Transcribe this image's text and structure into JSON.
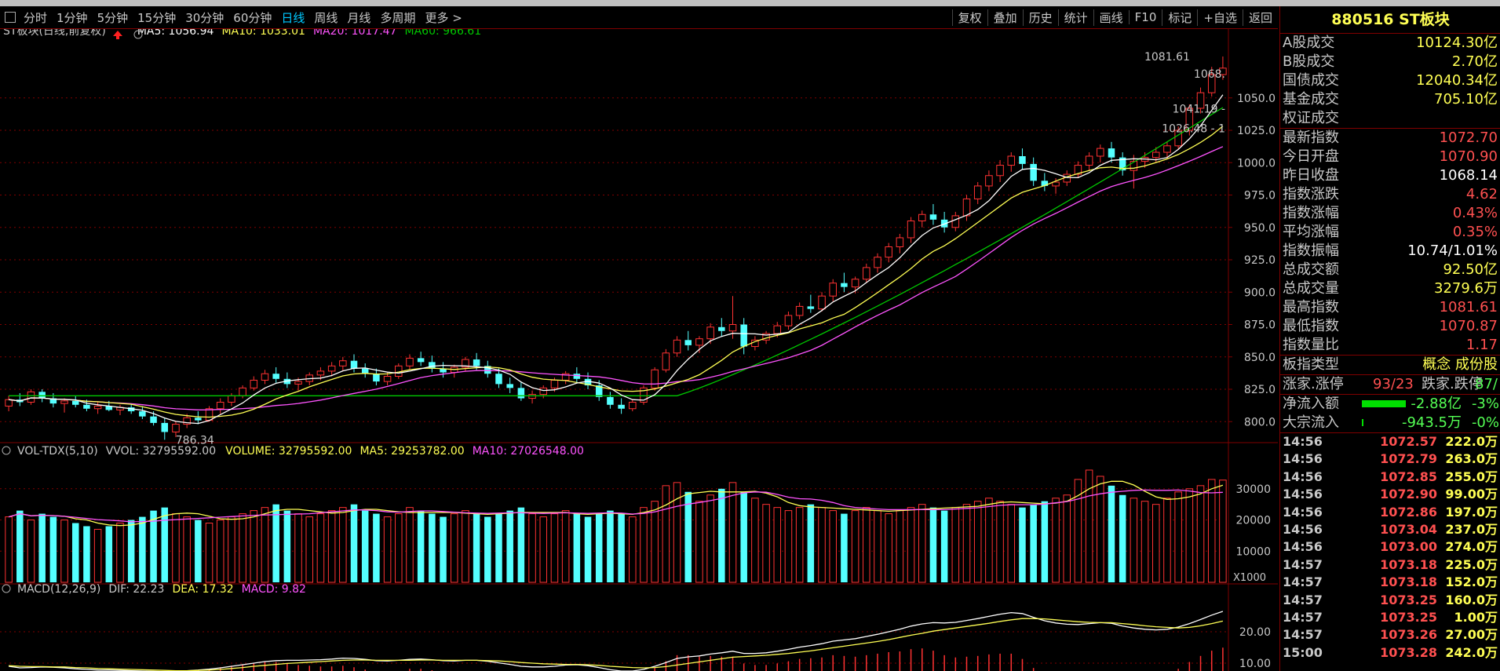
{
  "toolbar": {
    "periods": [
      "分时",
      "1分钟",
      "5分钟",
      "15分钟",
      "30分钟",
      "60分钟",
      "日线",
      "周线",
      "月线",
      "多周期",
      "更多 >"
    ],
    "active_period": "日线",
    "tools": [
      "复权",
      "叠加",
      "历史",
      "统计",
      "画线",
      "F10",
      "标记",
      "+自选",
      "返回"
    ]
  },
  "kline_header": {
    "title": "ST板块(日线,前复权)",
    "ma5": "MA5: 1056.94",
    "ma10": "MA10: 1033.01",
    "ma20": "MA20: 1017.47",
    "ma60": "MA60: 966.61"
  },
  "vol_header": {
    "title": "VOL-TDX(5,10)",
    "vvol": "VVOL: 32795592.00",
    "volume": "VOLUME: 32795592.00",
    "ma5": "MA5: 29253782.00",
    "ma10": "MA10: 27026548.00",
    "unit": "X1000"
  },
  "macd_header": {
    "title": "MACD(12,26,9)",
    "dif": "DIF: 22.23",
    "dea": "DEA: 17.32",
    "macd": "MACD: 9.82"
  },
  "colors": {
    "up": "#ff3232",
    "down": "#54ffff",
    "ma5": "#ffffff",
    "ma10": "#ffff54",
    "ma20": "#ff54ff",
    "ma60": "#00c800",
    "grid": "#800000"
  },
  "chart_data": {
    "type": "candlestick",
    "y_ticks": [
      800,
      825,
      850,
      875,
      900,
      925,
      950,
      975,
      1000,
      1025,
      1050
    ],
    "ylim": [
      785,
      1085
    ],
    "annotations": {
      "high": "1081.61",
      "low": "786.34",
      "right_labels": [
        "1068.",
        "1041.19 -",
        "1026.48 - 1"
      ]
    },
    "vol_ticks": [
      10000,
      20000,
      30000
    ],
    "vol_ylim": [
      0,
      37000
    ],
    "macd_ticks": [
      10.0,
      20.0
    ],
    "macd_ylim": [
      7.5,
      30
    ],
    "candles": [
      [
        812,
        820,
        808,
        817
      ],
      [
        817,
        822,
        812,
        815
      ],
      [
        815,
        825,
        813,
        823
      ],
      [
        823,
        825,
        815,
        818
      ],
      [
        818,
        822,
        811,
        814
      ],
      [
        814,
        818,
        807,
        816
      ],
      [
        816,
        820,
        811,
        813
      ],
      [
        813,
        817,
        808,
        810
      ],
      [
        810,
        815,
        806,
        812
      ],
      [
        812,
        816,
        808,
        809
      ],
      [
        809,
        813,
        805,
        811
      ],
      [
        811,
        814,
        806,
        808
      ],
      [
        808,
        812,
        802,
        804
      ],
      [
        804,
        808,
        797,
        799
      ],
      [
        799,
        803,
        786,
        792
      ],
      [
        792,
        800,
        788,
        798
      ],
      [
        798,
        806,
        795,
        803
      ],
      [
        803,
        808,
        798,
        801
      ],
      [
        801,
        812,
        800,
        810
      ],
      [
        810,
        818,
        806,
        815
      ],
      [
        815,
        822,
        812,
        820
      ],
      [
        820,
        828,
        818,
        826
      ],
      [
        826,
        835,
        824,
        832
      ],
      [
        832,
        840,
        829,
        837
      ],
      [
        837,
        842,
        830,
        833
      ],
      [
        833,
        838,
        826,
        829
      ],
      [
        829,
        834,
        824,
        831
      ],
      [
        831,
        838,
        828,
        836
      ],
      [
        836,
        842,
        832,
        839
      ],
      [
        839,
        846,
        835,
        843
      ],
      [
        843,
        850,
        839,
        847
      ],
      [
        847,
        852,
        838,
        841
      ],
      [
        841,
        845,
        834,
        837
      ],
      [
        837,
        841,
        828,
        831
      ],
      [
        831,
        838,
        828,
        835
      ],
      [
        835,
        845,
        833,
        843
      ],
      [
        843,
        852,
        840,
        849
      ],
      [
        849,
        854,
        843,
        846
      ],
      [
        846,
        851,
        838,
        841
      ],
      [
        841,
        846,
        834,
        838
      ],
      [
        838,
        844,
        834,
        842
      ],
      [
        842,
        850,
        839,
        848
      ],
      [
        848,
        853,
        840,
        843
      ],
      [
        843,
        847,
        834,
        837
      ],
      [
        837,
        841,
        826,
        829
      ],
      [
        829,
        834,
        822,
        826
      ],
      [
        826,
        831,
        816,
        818
      ],
      [
        818,
        824,
        814,
        821
      ],
      [
        821,
        828,
        818,
        826
      ],
      [
        826,
        834,
        823,
        832
      ],
      [
        832,
        839,
        829,
        837
      ],
      [
        837,
        842,
        830,
        833
      ],
      [
        833,
        838,
        825,
        828
      ],
      [
        828,
        832,
        816,
        819
      ],
      [
        819,
        823,
        810,
        813
      ],
      [
        813,
        818,
        806,
        810
      ],
      [
        810,
        817,
        808,
        815
      ],
      [
        815,
        828,
        813,
        826
      ],
      [
        826,
        842,
        824,
        840
      ],
      [
        840,
        856,
        838,
        853
      ],
      [
        853,
        866,
        850,
        863
      ],
      [
        863,
        870,
        855,
        859
      ],
      [
        859,
        866,
        853,
        864
      ],
      [
        864,
        876,
        860,
        873
      ],
      [
        873,
        880,
        866,
        870
      ],
      [
        870,
        897,
        864,
        875
      ],
      [
        875,
        880,
        852,
        858
      ],
      [
        858,
        866,
        855,
        863
      ],
      [
        863,
        870,
        860,
        868
      ],
      [
        868,
        877,
        865,
        874
      ],
      [
        874,
        885,
        871,
        882
      ],
      [
        882,
        892,
        879,
        889
      ],
      [
        889,
        898,
        884,
        887
      ],
      [
        887,
        900,
        885,
        897
      ],
      [
        897,
        910,
        893,
        907
      ],
      [
        907,
        915,
        900,
        904
      ],
      [
        904,
        912,
        899,
        910
      ],
      [
        910,
        922,
        907,
        919
      ],
      [
        919,
        930,
        915,
        927
      ],
      [
        927,
        938,
        923,
        935
      ],
      [
        935,
        945,
        930,
        942
      ],
      [
        942,
        958,
        938,
        955
      ],
      [
        955,
        963,
        950,
        960
      ],
      [
        960,
        968,
        952,
        956
      ],
      [
        956,
        962,
        946,
        950
      ],
      [
        950,
        962,
        947,
        959
      ],
      [
        959,
        975,
        955,
        972
      ],
      [
        972,
        985,
        968,
        982
      ],
      [
        982,
        994,
        978,
        990
      ],
      [
        990,
        1002,
        985,
        998
      ],
      [
        998,
        1008,
        993,
        1005
      ],
      [
        1005,
        1011,
        995,
        999
      ],
      [
        999,
        1004,
        982,
        986
      ],
      [
        986,
        992,
        978,
        982
      ],
      [
        982,
        988,
        976,
        985
      ],
      [
        985,
        994,
        982,
        991
      ],
      [
        991,
        1001,
        988,
        998
      ],
      [
        998,
        1008,
        994,
        1005
      ],
      [
        1005,
        1014,
        1000,
        1011
      ],
      [
        1011,
        1016,
        1000,
        1004
      ],
      [
        1004,
        1008,
        990,
        994
      ],
      [
        994,
        1006,
        980,
        1001
      ],
      [
        1001,
        1008,
        996,
        1004
      ],
      [
        1004,
        1012,
        1000,
        1008
      ],
      [
        1008,
        1016,
        1003,
        1013
      ],
      [
        1013,
        1028,
        1010,
        1025
      ],
      [
        1025,
        1045,
        1021,
        1042
      ],
      [
        1042,
        1058,
        1038,
        1054
      ],
      [
        1054,
        1074,
        1051,
        1068
      ],
      [
        1068,
        1082,
        1064,
        1073
      ]
    ],
    "volumes": [
      21000,
      23000,
      20000,
      22000,
      21000,
      20000,
      19000,
      18000,
      17000,
      18000,
      19000,
      20000,
      21000,
      23000,
      24000,
      22000,
      21000,
      20000,
      19000,
      20000,
      21000,
      22000,
      23000,
      24000,
      25000,
      23000,
      22000,
      21000,
      22000,
      23000,
      24000,
      25000,
      23000,
      22000,
      21000,
      22000,
      24000,
      23000,
      22000,
      21000,
      22000,
      23000,
      22000,
      21000,
      22000,
      23000,
      24000,
      22000,
      21000,
      22000,
      23000,
      22000,
      21000,
      22000,
      23000,
      22000,
      21000,
      24000,
      26000,
      31000,
      32000,
      29000,
      26000,
      28000,
      30000,
      32000,
      29000,
      27000,
      25000,
      24000,
      23000,
      24000,
      25000,
      24000,
      23000,
      22000,
      23000,
      24000,
      23000,
      22000,
      23000,
      24000,
      25000,
      24000,
      23000,
      24000,
      25000,
      26000,
      27000,
      26000,
      25000,
      24000,
      25000,
      26000,
      27000,
      28000,
      33000,
      36000,
      34000,
      31000,
      28000,
      27000,
      26000,
      25000,
      27000,
      29000,
      30000,
      31000,
      33000,
      32795
    ],
    "dif": [
      9,
      8.5,
      8.6,
      8.8,
      8.7,
      8.5,
      8.2,
      8,
      7.8,
      7.8,
      7.7,
      7.6,
      7.5,
      7.4,
      7.3,
      7.4,
      7.6,
      7.8,
      8.1,
      8.5,
      9,
      9.5,
      10,
      10.5,
      10.8,
      10.9,
      10.9,
      11,
      11.1,
      11.3,
      11.6,
      11.5,
      11.2,
      10.8,
      10.7,
      10.9,
      11.2,
      11.3,
      11.1,
      10.8,
      10.7,
      10.9,
      10.9,
      10.6,
      10.1,
      9.6,
      9,
      8.8,
      8.8,
      9,
      9.4,
      9.5,
      9.2,
      8.6,
      7.9,
      7.5,
      7.5,
      8,
      9,
      10.2,
      11.5,
      12,
      12.3,
      12.9,
      13.3,
      13.8,
      13.1,
      13.1,
      13.3,
      13.8,
      14.4,
      15.1,
      15.6,
      16.2,
      17,
      17.4,
      17.8,
      18.5,
      19.2,
      20,
      20.8,
      21.8,
      22.5,
      22.9,
      22.8,
      23,
      23.6,
      24.2,
      24.9,
      25.6,
      26.1,
      25.8,
      24.6,
      23.5,
      22.8,
      22.4,
      22.3,
      22.6,
      22.9,
      22.7,
      21.8,
      21.2,
      20.8,
      20.6,
      20.8,
      21.5,
      22.6,
      23.9,
      25.3,
      26.5
    ],
    "dea": [
      9.2,
      9,
      8.9,
      8.9,
      8.8,
      8.8,
      8.6,
      8.5,
      8.3,
      8.2,
      8.1,
      8,
      7.9,
      7.8,
      7.7,
      7.6,
      7.6,
      7.7,
      7.8,
      8,
      8.3,
      8.6,
      9,
      9.3,
      9.6,
      9.9,
      10.1,
      10.3,
      10.5,
      10.7,
      10.9,
      11,
      11,
      10.9,
      10.9,
      10.9,
      10.9,
      11,
      11,
      10.9,
      10.9,
      10.9,
      10.9,
      10.8,
      10.7,
      10.5,
      10.2,
      10,
      9.8,
      9.7,
      9.6,
      9.6,
      9.5,
      9.3,
      9,
      8.8,
      8.6,
      8.5,
      8.6,
      8.9,
      9.4,
      9.9,
      10.4,
      10.9,
      11.4,
      11.9,
      12.1,
      12.3,
      12.5,
      12.8,
      13.1,
      13.5,
      13.9,
      14.4,
      14.9,
      15.4,
      15.9,
      16.4,
      16.9,
      17.5,
      18.2,
      18.9,
      19.5,
      20.2,
      20.7,
      21.2,
      21.7,
      22.2,
      22.7,
      23.3,
      23.8,
      24.2,
      24.2,
      24.1,
      23.8,
      23.5,
      23.2,
      23,
      22.9,
      22.9,
      22.6,
      22.3,
      21.9,
      21.6,
      21.4,
      21.2,
      21.4,
      21.9,
      22.6,
      23.4
    ]
  },
  "panel": {
    "title": "880516 ST板块",
    "stats1": [
      {
        "label": "A股成交",
        "value": "10124.30亿",
        "color": "#ffff54"
      },
      {
        "label": "B股成交",
        "value": "2.70亿",
        "color": "#ffff54"
      },
      {
        "label": "国债成交",
        "value": "12040.34亿",
        "color": "#ffff54"
      },
      {
        "label": "基金成交",
        "value": "705.10亿",
        "color": "#ffff54"
      },
      {
        "label": "权证成交",
        "value": "",
        "color": "#ffff54"
      }
    ],
    "stats2": [
      {
        "label": "最新指数",
        "value": "1072.70",
        "color": "#ff5050"
      },
      {
        "label": "今日开盘",
        "value": "1070.90",
        "color": "#ff5050"
      },
      {
        "label": "昨日收盘",
        "value": "1068.14",
        "color": "#ffffff"
      },
      {
        "label": "指数涨跌",
        "value": "4.62",
        "color": "#ff5050"
      },
      {
        "label": "指数涨幅",
        "value": "0.43%",
        "color": "#ff5050"
      },
      {
        "label": "平均涨幅",
        "value": "0.35%",
        "color": "#ff5050"
      },
      {
        "label": "指数振幅",
        "value": "10.74/1.01%",
        "color": "#ffffff"
      },
      {
        "label": "总成交额",
        "value": "92.50亿",
        "color": "#ffff54"
      },
      {
        "label": "总成交量",
        "value": "3279.6万",
        "color": "#ffff54"
      },
      {
        "label": "最高指数",
        "value": "1081.61",
        "color": "#ff5050"
      },
      {
        "label": "最低指数",
        "value": "1070.87",
        "color": "#ff5050"
      },
      {
        "label": "指数量比",
        "value": "1.17",
        "color": "#ff5050"
      }
    ],
    "type_label": "板指类型",
    "type_value": "概念 成份股",
    "zt_label": "涨家.涨停",
    "zt_value": "93/23",
    "dt_label": "跌家.跌停",
    "dt_value": "87/",
    "flow": [
      {
        "label": "净流入额",
        "value": "-2.88亿",
        "pct": "-3%"
      },
      {
        "label": "大宗流入",
        "value": "-943.5万",
        "pct": "-0%"
      }
    ],
    "ticks": [
      {
        "t": "14:56",
        "p": "1072.57",
        "q": "222.0万"
      },
      {
        "t": "14:56",
        "p": "1072.79",
        "q": "263.0万"
      },
      {
        "t": "14:56",
        "p": "1072.85",
        "q": "255.0万"
      },
      {
        "t": "14:56",
        "p": "1072.90",
        "q": "99.00万"
      },
      {
        "t": "14:56",
        "p": "1072.86",
        "q": "197.0万"
      },
      {
        "t": "14:56",
        "p": "1073.04",
        "q": "237.0万"
      },
      {
        "t": "14:56",
        "p": "1073.00",
        "q": "274.0万"
      },
      {
        "t": "14:57",
        "p": "1073.18",
        "q": "225.0万"
      },
      {
        "t": "14:57",
        "p": "1073.18",
        "q": "152.0万"
      },
      {
        "t": "14:57",
        "p": "1073.25",
        "q": "160.0万"
      },
      {
        "t": "14:57",
        "p": "1073.25",
        "q": "1.00万"
      },
      {
        "t": "14:57",
        "p": "1073.26",
        "q": "27.00万"
      },
      {
        "t": "15:00",
        "p": "1073.28",
        "q": "242.0万"
      }
    ]
  }
}
